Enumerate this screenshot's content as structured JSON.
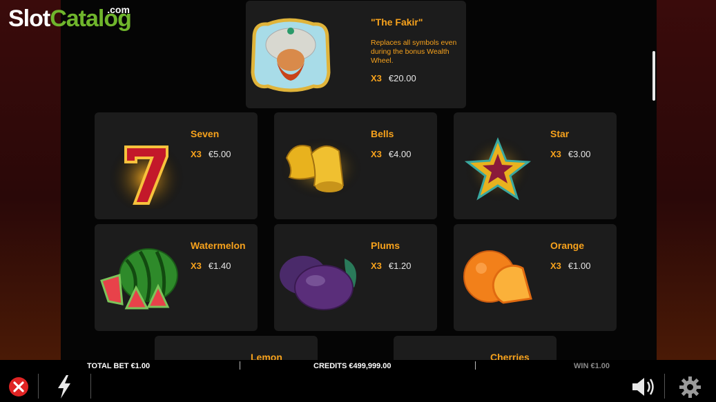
{
  "logo": {
    "slot": "Slot",
    "catalog": "Catalog",
    "com": ".com"
  },
  "fakir": {
    "name": "\"The Fakir\"",
    "desc": "Replaces all symbols even during the bonus Wealth Wheel.",
    "mult": "X3",
    "amount": "€20.00"
  },
  "symbols": [
    {
      "name": "Seven",
      "mult": "X3",
      "amount": "€5.00",
      "icon": "seven-icon"
    },
    {
      "name": "Bells",
      "mult": "X3",
      "amount": "€4.00",
      "icon": "bells-icon"
    },
    {
      "name": "Star",
      "mult": "X3",
      "amount": "€3.00",
      "icon": "star-icon"
    },
    {
      "name": "Watermelon",
      "mult": "X3",
      "amount": "€1.40",
      "icon": "watermelon-icon"
    },
    {
      "name": "Plums",
      "mult": "X3",
      "amount": "€1.20",
      "icon": "plums-icon"
    },
    {
      "name": "Orange",
      "mult": "X3",
      "amount": "€1.00",
      "icon": "orange-icon"
    },
    {
      "name": "Lemon",
      "icon": "lemon-icon"
    },
    {
      "name": "Cherries",
      "icon": "cherries-icon"
    }
  ],
  "bar": {
    "total_bet_label": "TOTAL BET",
    "total_bet_value": "€1.00",
    "credits_label": "CREDITS",
    "credits_value": "€499,999.00",
    "win_label": "WIN",
    "win_value": "€1.00"
  },
  "colors": {
    "accent": "#f7a21c",
    "card": "#1c1c1c",
    "close": "#e02424"
  }
}
